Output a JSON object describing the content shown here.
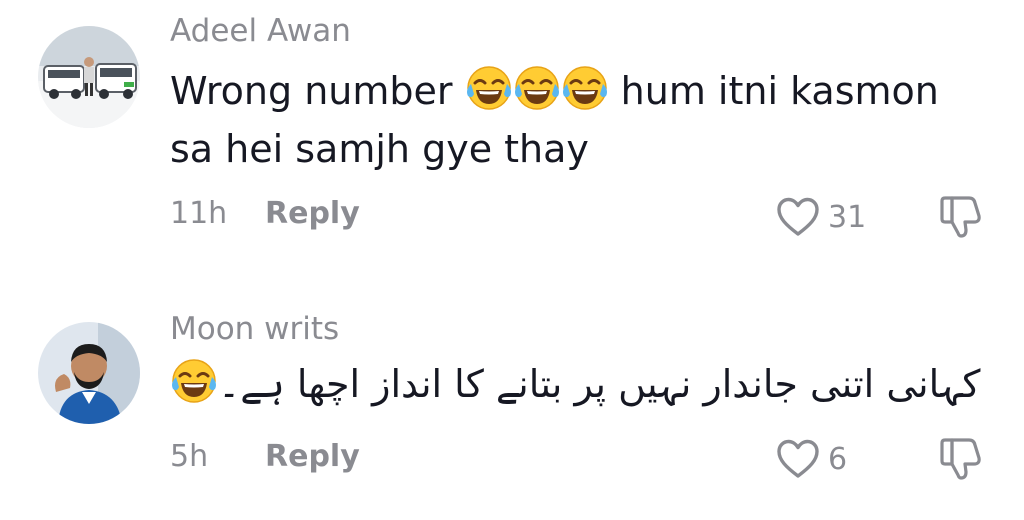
{
  "comments": [
    {
      "username": "Adeel Awan",
      "text_line1_before": "Wrong number ",
      "text_line1_after": " hum itni kasmon",
      "text_line2": "sa hei samjh gye thay",
      "emoji": "face-with-tears-of-joy",
      "time": "11h",
      "reply_label": "Reply",
      "likes": "31"
    },
    {
      "username": "Moon writs",
      "text": "کہانی اتنی جاندار نہیں پر بتانے کا انداز اچھا ہے۔",
      "emoji": "face-with-tears-of-joy",
      "time": "5h",
      "reply_label": "Reply",
      "likes": "6"
    }
  ],
  "colors": {
    "text": "#161823",
    "muted": "#8a8b91",
    "background": "#ffffff"
  }
}
